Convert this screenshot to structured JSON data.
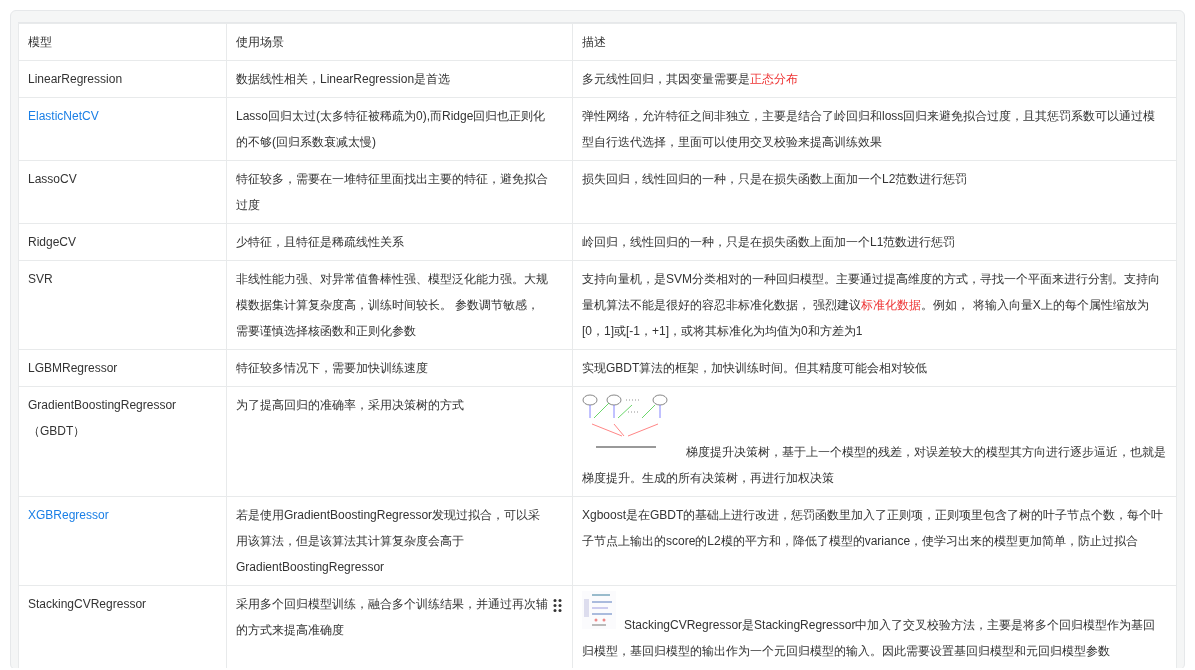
{
  "table": {
    "columns": [
      "模型",
      "使用场景",
      "描述"
    ],
    "rows": [
      {
        "model": "LinearRegression",
        "link": false,
        "scenario": "数据线性相关，LinearRegression是首选",
        "description": [
          {
            "kind": "text",
            "text": "多元线性回归，其因变量需要是"
          },
          {
            "kind": "highlight",
            "text": "正态分布"
          }
        ]
      },
      {
        "model": "ElasticNetCV",
        "link": true,
        "scenario": "Lasso回归太过(太多特征被稀疏为0),而Ridge回归也正则化的不够(回归系数衰减太慢)",
        "description": [
          {
            "kind": "text",
            "text": "弹性网络，允许特征之间非独立，主要是结合了岭回归和loss回归来避免拟合过度，且其惩罚系数可以通过模型自行迭代选择，里面可以使用交叉校验来提高训练效果"
          }
        ]
      },
      {
        "model": "LassoCV",
        "link": false,
        "scenario": "特征较多，需要在一堆特征里面找出主要的特征，避免拟合过度",
        "description": [
          {
            "kind": "text",
            "text": "损失回归，线性回归的一种，只是在损失函数上面加一个L2范数进行惩罚"
          }
        ]
      },
      {
        "model": "RidgeCV",
        "link": false,
        "scenario": "少特征，且特征是稀疏线性关系",
        "description": [
          {
            "kind": "text",
            "text": "岭回归，线性回归的一种，只是在损失函数上面加一个L1范数进行惩罚"
          }
        ]
      },
      {
        "model": "SVR",
        "link": false,
        "scenario": "非线性能力强、对异常值鲁棒性强、模型泛化能力强。大规模数据集计算复杂度高，训练时间较长。 参数调节敏感，需要谨慎选择核函数和正则化参数",
        "description": [
          {
            "kind": "text",
            "text": "支持向量机，是SVM分类相对的一种回归模型。主要通过提高维度的方式，寻找一个平面来进行分割。支持向量机算法不能是很好的容忍非标准化数据， 强烈建议"
          },
          {
            "kind": "highlight",
            "text": "标准化数据"
          },
          {
            "kind": "text",
            "text": "。例如， 将输入向量X上的每个属性缩放为[0，1]或[-1，+1]，或将其标准化为均值为0和方差为1"
          }
        ]
      },
      {
        "model": "LGBMRegressor",
        "link": false,
        "scenario": "特征较多情况下，需要加快训练速度",
        "description": [
          {
            "kind": "text",
            "text": "实现GBDT算法的框架，加快训练时间。但其精度可能会相对较低"
          }
        ]
      },
      {
        "model": "GradientBoostingRegressor（GBDT）",
        "link": false,
        "scenario": "为了提高回归的准确率，采用决策树的方式",
        "description": [
          {
            "kind": "diagram"
          },
          {
            "kind": "text",
            "text": "梯度提升决策树，基于上一个模型的残差，对误差较大的模型其方向进行逐步逼近，也就是梯度提升。生成的所有决策树，再进行加权决策"
          }
        ]
      },
      {
        "model": "XGBRegressor",
        "link": true,
        "scenario": "若是使用GradientBoostingRegressor发现过拟合，可以采用该算法，但是该算法其计算复杂度会高于GradientBoostingRegressor",
        "description": [
          {
            "kind": "text",
            "text": "Xgboost是在GBDT的基础上进行改进，惩罚函数里加入了正则项，正则项里包含了树的叶子节点个数，每个叶子节点上输出的score的L2模的平方和，降低了模型的variance，使学习出来的模型更加简单，防止过拟合"
          }
        ]
      },
      {
        "model": "StackingCVRegressor",
        "link": false,
        "scenario": "采用多个回归模型训练，融合多个训练结果，并通过再次辅的方式来提高准确度",
        "handle": true,
        "description": [
          {
            "kind": "picture"
          },
          {
            "kind": "text",
            "text": "StackingCVRegressor是StackingRegressor中加入了交叉校验方法，主要是将多个回归模型作为基回归模型，基回归模型的输出作为一个元回归模型的输入。因此需要设置基回归模型和元回归模型参数"
          }
        ]
      }
    ]
  }
}
